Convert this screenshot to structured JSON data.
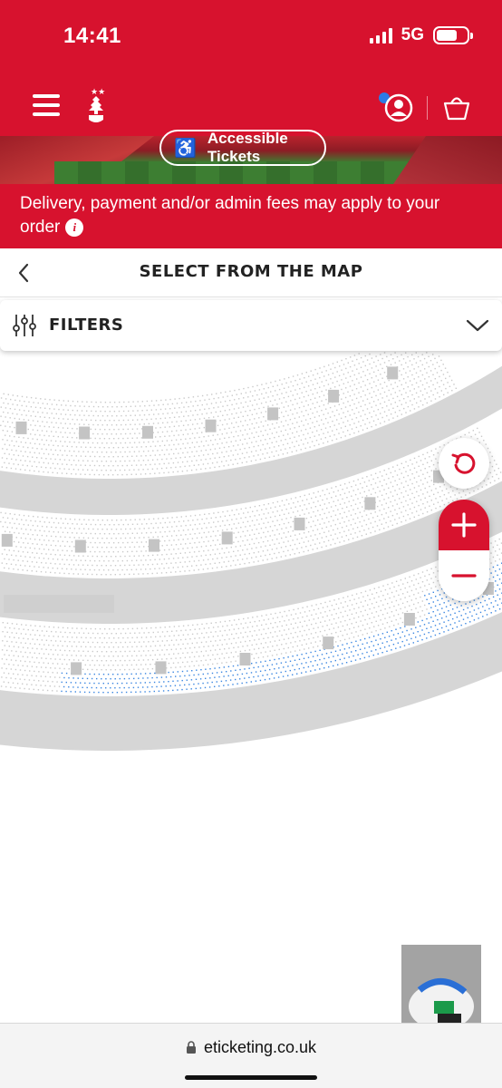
{
  "status_bar": {
    "time": "14:41",
    "network": "5G",
    "battery_level": 0.7
  },
  "header": {
    "menu_icon": "hamburger-menu-icon",
    "logo": "club-crest-logo",
    "account_icon": "user-account-icon",
    "basket_icon": "shopping-basket-icon",
    "brand_color": "#d7122e",
    "notification_dot_color": "#2c7be5"
  },
  "banner": {
    "accessible_label": "Accessible Tickets",
    "icon": "wheelchair-icon"
  },
  "fee_notice": {
    "text": "Delivery, payment and/or admin fees may apply to your order",
    "icon": "info-icon"
  },
  "page": {
    "title": "SELECT FROM THE MAP",
    "back_icon": "chevron-left-icon"
  },
  "filters": {
    "label": "FILTERS",
    "icon": "sliders-icon",
    "chevron": "chevron-down-icon"
  },
  "map": {
    "controls": {
      "reset_icon": "reset-view-icon",
      "zoom_in_icon": "plus-icon",
      "zoom_out_icon": "minus-icon"
    },
    "available_seat_color": "#3a86e0",
    "unavailable_seat_color": "#c9c9c9"
  },
  "browser": {
    "url": "eticketing.co.uk",
    "lock_icon": "lock-icon"
  }
}
